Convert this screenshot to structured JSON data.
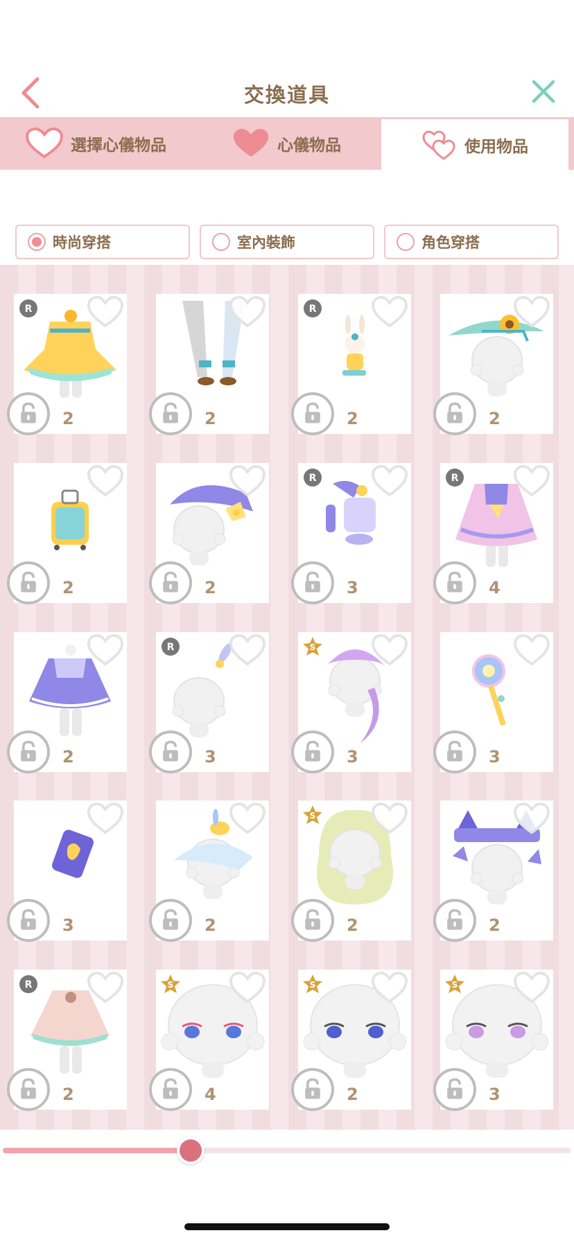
{
  "header": {
    "title": "交換道具"
  },
  "tabs": [
    {
      "label": "選擇心儀物品",
      "icon": "heart-outline-icon"
    },
    {
      "label": "心儀物品",
      "icon": "heart-filled-icon"
    },
    {
      "label": "使用物品",
      "icon": "double-heart-icon"
    }
  ],
  "filters": [
    {
      "label": "時尚穿搭",
      "selected": true
    },
    {
      "label": "室內裝飾",
      "selected": false
    },
    {
      "label": "角色穿搭",
      "selected": false
    }
  ],
  "items": [
    {
      "rank": "R",
      "qty": "2",
      "art": "yellow-dress"
    },
    {
      "rank": "",
      "qty": "2",
      "art": "white-stockings"
    },
    {
      "rank": "R",
      "qty": "2",
      "art": "bunny-charm"
    },
    {
      "rank": "",
      "qty": "2",
      "art": "sunflower-hat"
    },
    {
      "rank": "",
      "qty": "2",
      "art": "suitcase"
    },
    {
      "rank": "",
      "qty": "2",
      "art": "purple-hat"
    },
    {
      "rank": "R",
      "qty": "3",
      "art": "purple-accessory-set"
    },
    {
      "rank": "R",
      "qty": "4",
      "art": "pastel-sailor-dress"
    },
    {
      "rank": "",
      "qty": "2",
      "art": "purple-dress"
    },
    {
      "rank": "R",
      "qty": "3",
      "art": "bunny-hairpin"
    },
    {
      "rank": "S",
      "qty": "3",
      "art": "purple-hair"
    },
    {
      "rank": "",
      "qty": "3",
      "art": "lollipop-wand"
    },
    {
      "rank": "",
      "qty": "3",
      "art": "jam-jar"
    },
    {
      "rank": "",
      "qty": "2",
      "art": "white-cap"
    },
    {
      "rank": "S",
      "qty": "2",
      "art": "green-curly-hair"
    },
    {
      "rank": "",
      "qty": "2",
      "art": "cat-ear-headdress"
    },
    {
      "rank": "R",
      "qty": "2",
      "art": "peach-dress"
    },
    {
      "rank": "S",
      "qty": "4",
      "art": "pink-eyes-face"
    },
    {
      "rank": "S",
      "qty": "2",
      "art": "blue-eyes-face"
    },
    {
      "rank": "S",
      "qty": "3",
      "art": "pink-violet-eyes-face"
    }
  ],
  "scroll": {
    "position_fraction": 0.33
  },
  "colors": {
    "accent": "#f08d98",
    "tab_bg": "#f2c9cd",
    "text": "#8a6e4f",
    "rank_r": "#777777",
    "rank_s": "#d9a33a"
  }
}
